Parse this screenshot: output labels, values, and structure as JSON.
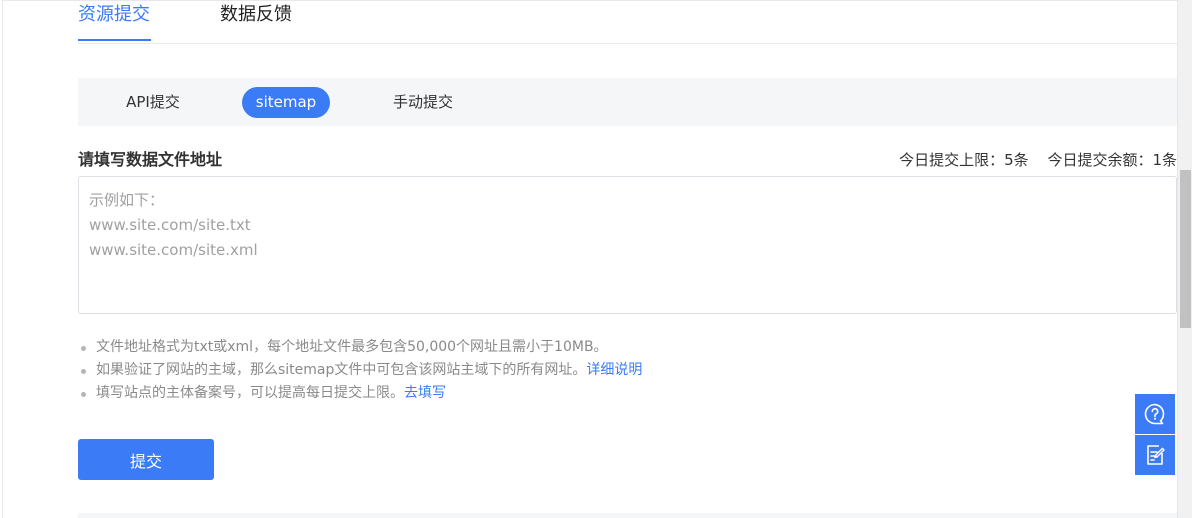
{
  "top_tabs": [
    {
      "label": "资源提交",
      "active": true
    },
    {
      "label": "数据反馈",
      "active": false
    }
  ],
  "sub_tabs": [
    {
      "label": "API提交",
      "active": false
    },
    {
      "label": "sitemap",
      "active": true
    },
    {
      "label": "手动提交",
      "active": false
    }
  ],
  "form": {
    "label": "请填写数据文件地址",
    "quota_limit": "今日提交上限：5条",
    "quota_remaining": "今日提交余额：1条",
    "placeholder": "示例如下：\nwww.site.com/site.txt\nwww.site.com/site.xml",
    "value": ""
  },
  "tips": [
    {
      "text": "文件地址格式为txt或xml，每个地址文件最多包含50,000个网址且需小于10MB。",
      "link": ""
    },
    {
      "text": "如果验证了网站的主域，那么sitemap文件中可包含该网站主域下的所有网址。",
      "link": "详细说明"
    },
    {
      "text": "填写站点的主体备案号，可以提高每日提交上限。",
      "link": "去填写"
    }
  ],
  "submit_label": "提交",
  "float_buttons": [
    {
      "icon": "help-chat-icon"
    },
    {
      "icon": "feedback-edit-icon"
    }
  ],
  "colors": {
    "accent": "#3b7bf5",
    "tip_text": "#8a8a8a",
    "bar_bg": "#f5f6f8"
  }
}
